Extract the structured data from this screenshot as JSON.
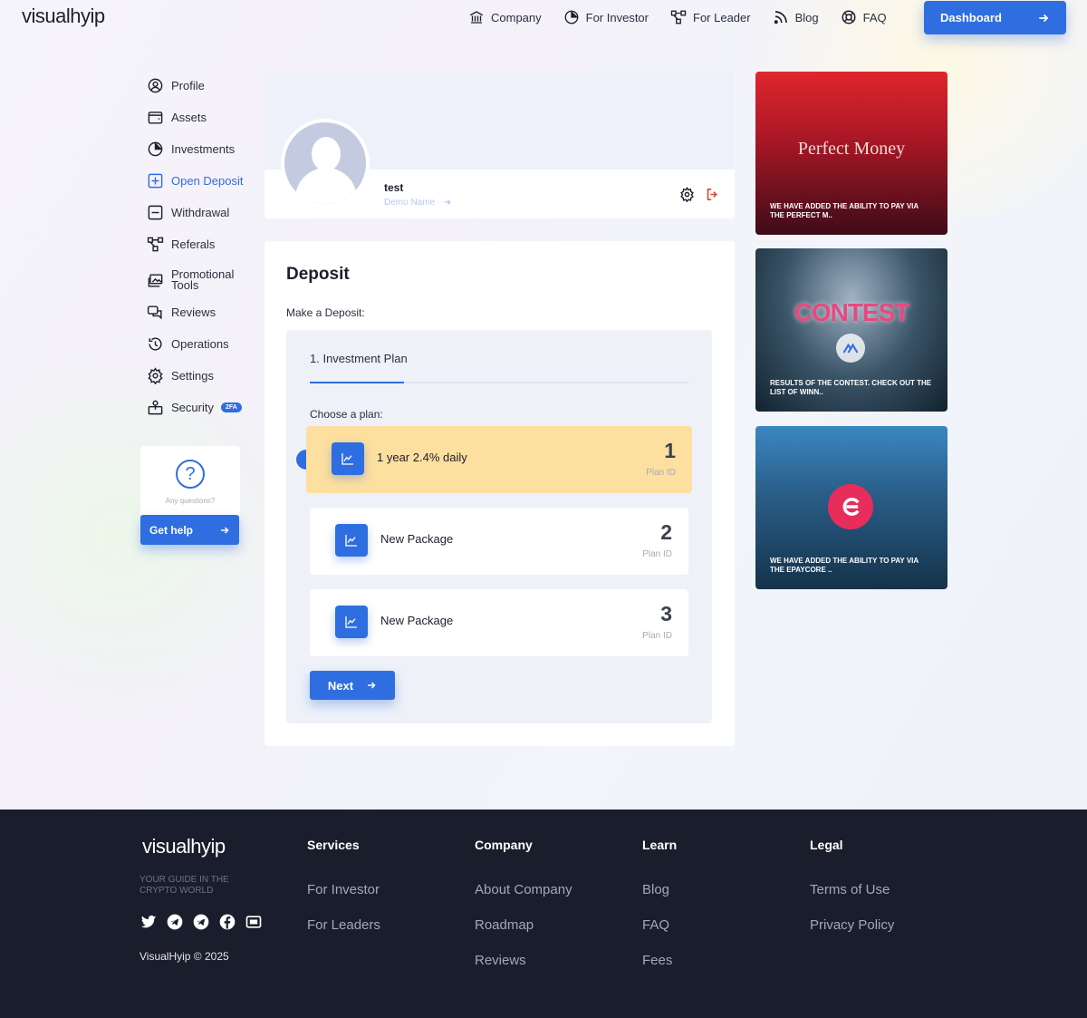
{
  "header": {
    "logo": "visualhyip",
    "nav": [
      {
        "label": "Company",
        "icon": "bank-icon"
      },
      {
        "label": "For Investor",
        "icon": "pie-chart-icon"
      },
      {
        "label": "For Leader",
        "icon": "network-icon"
      },
      {
        "label": "Blog",
        "icon": "rss-icon"
      },
      {
        "label": "FAQ",
        "icon": "lifebuoy-icon"
      }
    ],
    "dashboard_label": "Dashboard"
  },
  "sidebar": {
    "items": [
      {
        "label": "Profile",
        "icon": "user-circle-icon"
      },
      {
        "label": "Assets",
        "icon": "wallet-icon"
      },
      {
        "label": "Investments",
        "icon": "pie-chart-icon"
      },
      {
        "label": "Open Deposit",
        "icon": "plus-square-icon",
        "active": true
      },
      {
        "label": "Withdrawal",
        "icon": "minus-square-icon"
      },
      {
        "label": "Referals",
        "icon": "network-icon"
      },
      {
        "label": "Promotional Tools",
        "icon": "images-icon"
      },
      {
        "label": "Reviews",
        "icon": "chat-icon"
      },
      {
        "label": "Operations",
        "icon": "history-icon"
      },
      {
        "label": "Settings",
        "icon": "gear-icon"
      },
      {
        "label": "Security",
        "icon": "lock-icon",
        "badge": "2FA"
      }
    ],
    "help": {
      "text": "Any questions?",
      "button": "Get help"
    }
  },
  "profile": {
    "name": "test",
    "subtitle": "Demo Name"
  },
  "deposit": {
    "title": "Deposit",
    "subtitle": "Make a Deposit:",
    "step": "1. Investment Plan",
    "choose": "Choose a plan:",
    "plans": [
      {
        "name": "1 year 2.4% daily",
        "id": "1",
        "id_label": "Plan ID",
        "selected": true
      },
      {
        "name": "New Package",
        "id": "2",
        "id_label": "Plan ID",
        "selected": false
      },
      {
        "name": "New Package",
        "id": "3",
        "id_label": "Plan ID",
        "selected": false
      }
    ],
    "next": "Next"
  },
  "news": [
    {
      "logo_text": "Perfect Money",
      "caption": "WE HAVE ADDED THE ABILITY TO PAY VIA THE PERFECT M.."
    },
    {
      "logo_text": "CONTEST",
      "caption": "RESULTS OF THE CONTEST. CHECK OUT THE LIST OF WINN.."
    },
    {
      "caption": "WE HAVE ADDED THE ABILITY TO PAY VIA THE EPAYCORE .."
    }
  ],
  "footer": {
    "logo": "visualhyip",
    "tagline": "YOUR GUIDE IN THE CRYPTO WORLD",
    "copyright": "VisualHyip © 2025",
    "social": [
      "twitter-icon",
      "telegram-icon",
      "telegram-alt-icon",
      "facebook-icon",
      "youtube-icon"
    ],
    "columns": [
      {
        "title": "Services",
        "links": [
          "For Investor",
          "For Leaders"
        ]
      },
      {
        "title": "Company",
        "links": [
          "About Company",
          "Roadmap",
          "Reviews"
        ]
      },
      {
        "title": "Learn",
        "links": [
          "Blog",
          "FAQ",
          "Fees"
        ]
      },
      {
        "title": "Legal",
        "links": [
          "Terms of Use",
          "Privacy Policy"
        ]
      }
    ]
  },
  "colors": {
    "accent": "#2f6ee0",
    "selected_plan": "#fddf9f",
    "footer_bg": "#1a1d2b"
  }
}
